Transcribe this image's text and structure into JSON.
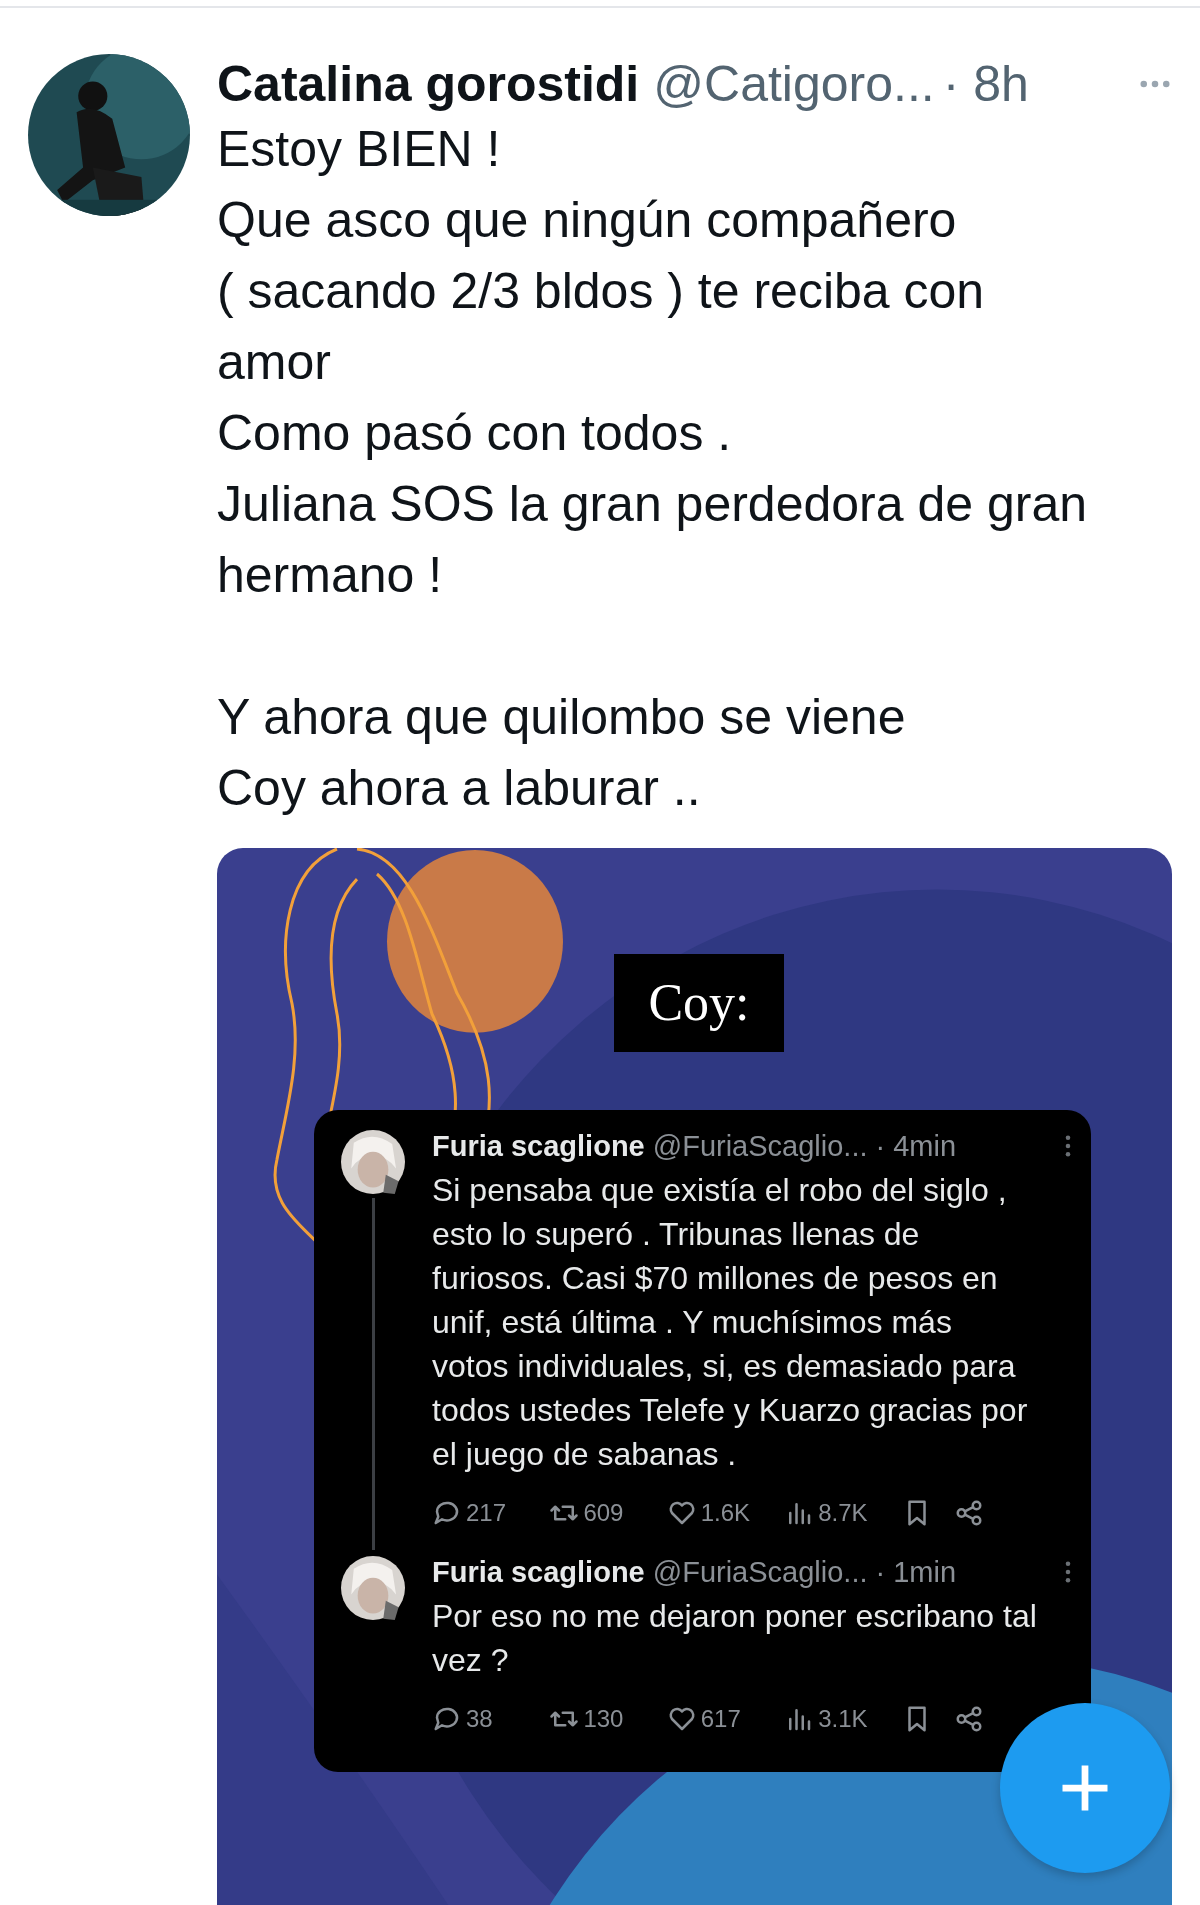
{
  "tweet": {
    "author": "Catalina gorostidi",
    "handle": "@Catigoro...",
    "time": "· 8h",
    "paragraphs": [
      [
        "Estoy BIEN !",
        "Que asco que ningún compañero",
        "( sacando 2/3 bldos ) te reciba con",
        "amor",
        "Como pasó con todos .",
        "Juliana SOS la gran perdedora de gran",
        "hermano !"
      ],
      [
        "Y ahora que quilombo se viene",
        "Coy ahora a laburar .."
      ]
    ],
    "media": {
      "caption": "Coy:",
      "posts": [
        {
          "author": "Furia scaglione",
          "handle": "@FuriaScaglio...",
          "time": "· 4min",
          "thread_line": true,
          "lines": [
            "Si pensaba que existía el robo del siglo ,",
            "esto lo superó . Tribunas llenas  de",
            "furiosos. Casi $70 millones de pesos en",
            "unif, está última . Y muchísimos más",
            "votos individuales, si, es demasiado para",
            "todos ustedes Telefe y Kuarzo gracias por",
            "el juego de sabanas   ."
          ],
          "actions": [
            {
              "kind": "reply",
              "count": "217"
            },
            {
              "kind": "retweet",
              "count": "609"
            },
            {
              "kind": "like",
              "count": "1.6K"
            },
            {
              "kind": "views",
              "count": "8.7K"
            },
            {
              "kind": "bookmark"
            },
            {
              "kind": "share"
            }
          ]
        },
        {
          "author": "Furia scaglione",
          "handle": "@FuriaScaglio...",
          "time": "· 1min",
          "thread_line": false,
          "lines": [
            "Por eso no me dejaron poner escribano tal",
            "vez ?"
          ],
          "actions": [
            {
              "kind": "reply",
              "count": "38"
            },
            {
              "kind": "retweet",
              "count": "130"
            },
            {
              "kind": "like",
              "count": "617"
            },
            {
              "kind": "views",
              "count": "3.1K"
            },
            {
              "kind": "bookmark"
            },
            {
              "kind": "share"
            }
          ]
        }
      ]
    }
  }
}
